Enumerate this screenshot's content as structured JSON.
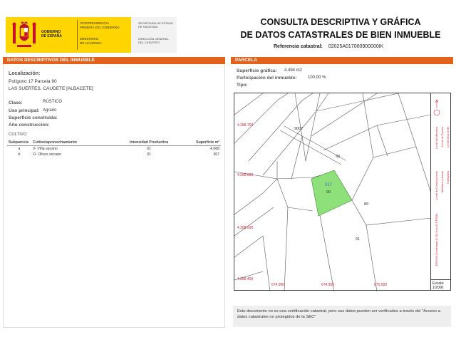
{
  "header": {
    "gov_label": "GOBIERNO\nDE ESPAÑA",
    "vice_label": "VICEPRESIDENCIA\nPRIMERA DEL GOBIERNO",
    "ministry_label": "MINISTERIO\nDE HACIENDA",
    "secretaria_label": "SECRETARÍA DE ESTADO\nDE HACIENDA",
    "direccion_label": "DIRECCIÓN GENERAL\nDEL CATASTRO",
    "title_line1": "CONSULTA DESCRIPTIVA Y GRÁFICA",
    "title_line2": "DE DATOS CATASTRALES DE BIEN INMUEBLE",
    "ref_label": "Referencia catastral:",
    "ref_value": "02025A017000900000IK",
    "colors": {
      "yellow": "#ffd500",
      "orange": "#e2621b",
      "parcel_green": "#8ee07a"
    }
  },
  "left": {
    "section_title": "DATOS DESCRIPTIVOS DEL INMUEBLE",
    "localizacion_label": "Localización:",
    "localizacion_line1": "Polígono 17 Parcela 90",
    "localizacion_line2": "LAS SUERTES. CAUDETE [ALBACETE]",
    "clase_label": "Clase:",
    "clase_value": "RÚSTICO",
    "uso_label": "Uso principal:",
    "uso_value": "Agrario",
    "superficie_label": "Superficie construida:",
    "anio_label": "Año construcción:",
    "cultivo_title": "CULTIVO",
    "table": {
      "headers": [
        "Subparcela",
        "Cultivo/aprovechamiento",
        "Intensidad Productiva",
        "Superficie m²"
      ],
      "rows": [
        [
          "a",
          "V- Viña secano",
          "01",
          "4.088"
        ],
        [
          "b",
          "O- Olivos secano",
          "01",
          "367"
        ]
      ]
    }
  },
  "right": {
    "section_title": "PARCELA",
    "sup_grafica_label": "Superficie gráfica:",
    "sup_grafica_value": "4.494 m2",
    "participacion_label": "Participación del inmueble:",
    "participacion_value": "100,00 %",
    "tipo_label": "Tipo:",
    "map": {
      "y_labels": [
        "4.288.700",
        "4.288.600",
        "4.288.500",
        "4.288.400"
      ],
      "x_labels": [
        "674.900",
        "674.950",
        "675.000"
      ],
      "parcel_labels": [
        "9007",
        "93",
        "90",
        "89",
        "91"
      ],
      "zone_label": "017",
      "side_text": "ETRS 89 Coordenadas U.T.M. Huso 30 ETRS89",
      "legend_items": [
        "Límite de Manzana",
        "Límite de Parcela",
        "Límite de Construcciones",
        "Mobiliario y aceras",
        "Límite zona verde",
        "Hidrografía"
      ],
      "scale_label": "Escala:",
      "scale_value": "1/2000"
    },
    "note": "Este documento no es una certificación catastral, pero sus datos pueden ser verificados a través del \"Acceso a datos catastrales no protegidos de la SEC\""
  }
}
